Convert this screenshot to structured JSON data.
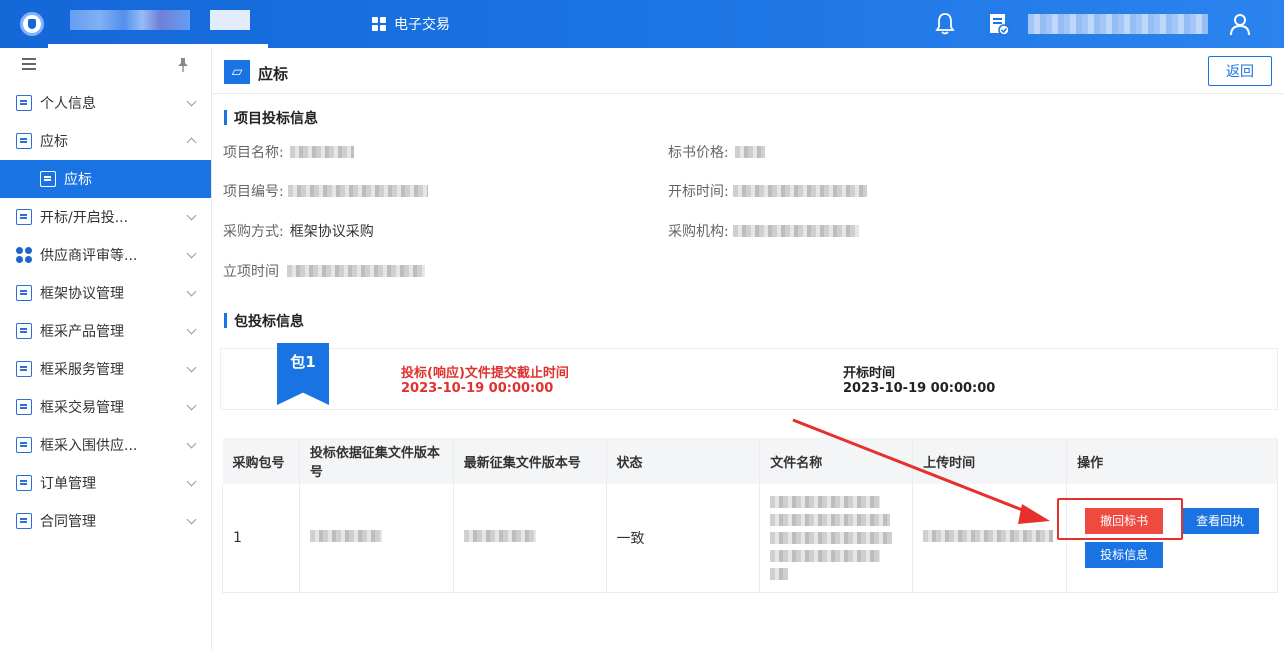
{
  "header": {
    "nav_title": "电子交易"
  },
  "sidebar": {
    "items": [
      {
        "label": "个人信息",
        "expanded": false
      },
      {
        "label": "应标",
        "expanded": true
      },
      {
        "label": "应标",
        "active": true,
        "sub": true
      },
      {
        "label": "开标/开启投...",
        "expanded": false
      },
      {
        "label": "供应商评审等...",
        "expanded": false
      },
      {
        "label": "框架协议管理",
        "expanded": false
      },
      {
        "label": "框采产品管理",
        "expanded": false
      },
      {
        "label": "框采服务管理",
        "expanded": false
      },
      {
        "label": "框采交易管理",
        "expanded": false
      },
      {
        "label": "框采入围供应...",
        "expanded": false
      },
      {
        "label": "订单管理",
        "expanded": false
      },
      {
        "label": "合同管理",
        "expanded": false
      }
    ]
  },
  "page": {
    "title": "应标",
    "back_label": "返回"
  },
  "project_info": {
    "section_title": "项目投标信息",
    "name_label": "项目名称:",
    "price_label": "标书价格:",
    "code_label": "项目编号:",
    "open_time_label": "开标时间:",
    "method_label": "采购方式:",
    "method_value": "框架协议采购",
    "agency_label": "采购机构:",
    "setup_time_label": "立项时间"
  },
  "package_info": {
    "section_title": "包投标信息",
    "package_badge": "包1",
    "deadline_label": "投标(响应)文件提交截止时间",
    "deadline_value": "2023-10-19 00:00:00",
    "open_label": "开标时间",
    "open_value": "2023-10-19 00:00:00"
  },
  "table": {
    "headers": [
      "采购包号",
      "投标依据征集文件版本号",
      "最新征集文件版本号",
      "状态",
      "文件名称",
      "上传时间",
      "操作"
    ],
    "rows": [
      {
        "package_no": "1",
        "status": "一致"
      }
    ],
    "actions": {
      "withdraw": "撤回标书",
      "view_receipt": "查看回执",
      "bid_info": "投标信息"
    }
  },
  "colors": {
    "primary": "#1a73e3",
    "danger": "#ee4a3f",
    "deadline_text": "#e0312e",
    "annotation": "#e5302b"
  }
}
